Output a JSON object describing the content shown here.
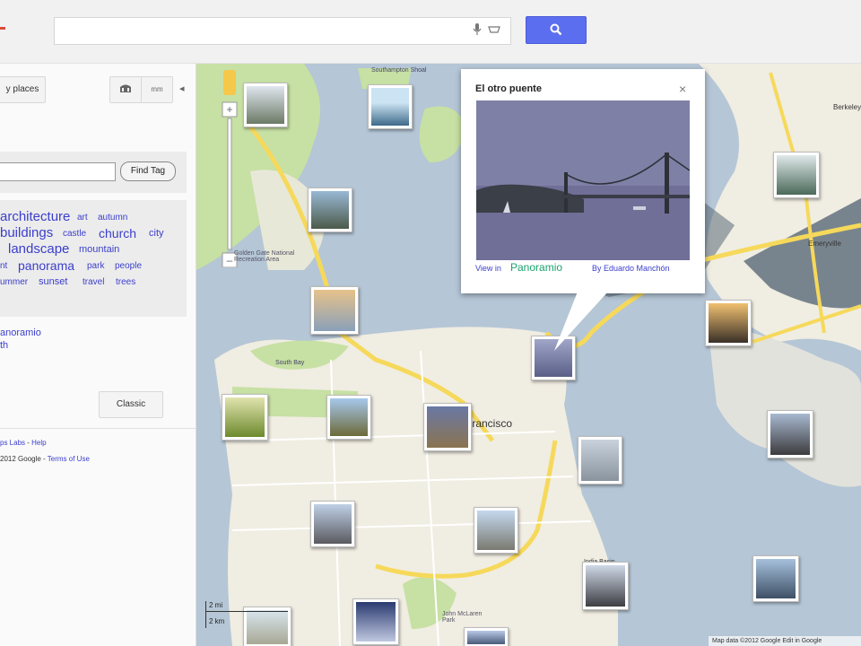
{
  "search": {
    "placeholder": ""
  },
  "sidebar": {
    "my_places_label": "y places",
    "segment_label": "mm",
    "find_tag_label": "Find Tag",
    "tags": [
      {
        "text": "architecture",
        "size": 15
      },
      {
        "text": "art",
        "size": 10
      },
      {
        "text": "autumn",
        "size": 10
      },
      {
        "text": "buildings",
        "size": 15
      },
      {
        "text": "castle",
        "size": 10
      },
      {
        "text": "church",
        "size": 14
      },
      {
        "text": "city",
        "size": 11
      },
      {
        "text": "landscape",
        "size": 15
      },
      {
        "text": "mountain",
        "size": 11
      },
      {
        "text": "nt",
        "size": 10
      },
      {
        "text": "panorama",
        "size": 14
      },
      {
        "text": "park",
        "size": 10
      },
      {
        "text": "people",
        "size": 10
      },
      {
        "text": "ummer",
        "size": 10
      },
      {
        "text": "sunset",
        "size": 11
      },
      {
        "text": "travel",
        "size": 10
      },
      {
        "text": "trees",
        "size": 10
      }
    ],
    "link_panoramio": "anoramio",
    "link_earth": "th",
    "classic_label": "Classic",
    "footer": {
      "labs_link": "ps Labs",
      "dash": " - ",
      "help_link": "Help",
      "copyright": "2012 Google - ",
      "terms_link": "Terms of Use"
    }
  },
  "infowindow": {
    "title": "El otro puente",
    "close": "×",
    "view_in": "View in",
    "panoramio": "Panoramio",
    "by": "By Eduardo Manchón"
  },
  "map": {
    "labels": [
      {
        "text": "Francisco",
        "size": 12
      },
      {
        "text": "Golden Gate National Recreation Area",
        "size": 7
      },
      {
        "text": "John McLaren Park",
        "size": 7
      },
      {
        "text": "Emeryville",
        "size": 8
      },
      {
        "text": "Berkeley",
        "size": 8
      },
      {
        "text": "Southampton Shoal",
        "size": 7
      },
      {
        "text": "South Bay",
        "size": 7
      },
      {
        "text": "India Basin Shoreline",
        "size": 7
      }
    ],
    "scale_mi": "2 mi",
    "scale_km": "2 km",
    "attribution": "Map data ©2012 Google  Edit in Google"
  },
  "colors": {
    "land": "#f0ede2",
    "park": "#c7e0a4",
    "water": "#b5c6d6",
    "road": "#f6d95b",
    "accent": "#5c6ef0",
    "link": "#3b3ecc"
  },
  "icons": [
    "mic-icon",
    "keyboard-icon",
    "search-icon",
    "camera-icon",
    "collapse-icon",
    "close-icon",
    "pegman-icon"
  ]
}
